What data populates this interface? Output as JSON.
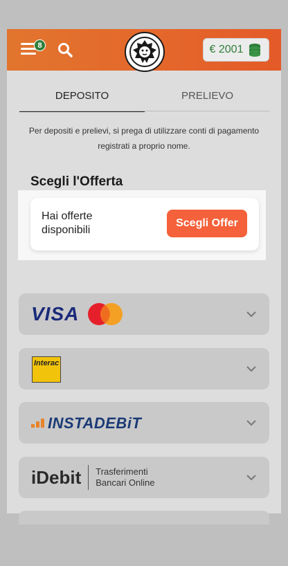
{
  "header": {
    "menu_badge": "8",
    "balance": "€ 2001",
    "icons": {
      "menu": "menu-icon",
      "search": "search-icon",
      "logo": "lion-logo-icon",
      "coins": "coins-icon"
    },
    "brand_color": "#e4662b",
    "balance_color": "#2f7e3a"
  },
  "tabs": [
    {
      "label": "DEPOSITO",
      "active": true
    },
    {
      "label": "PRELIEVO",
      "active": false
    }
  ],
  "notice": "Per depositi e prelievi, si prega di utilizzare conti di pagamento registrati a proprio nome.",
  "offer": {
    "section_title": "Scegli l'Offerta",
    "text": "Hai offerte disponibili",
    "button_label": "Scegli Offer",
    "button_color": "#f4613a"
  },
  "methods": [
    {
      "id": "visa-mastercard",
      "logo_text": "VISA"
    },
    {
      "id": "interac",
      "logo_text": "Interac"
    },
    {
      "id": "instadebit",
      "logo_text": "INSTADEBiT"
    },
    {
      "id": "idebit",
      "logo_text": "iDebit",
      "tagline_1": "Trasferimenti",
      "tagline_2": "Bancari Online"
    }
  ]
}
